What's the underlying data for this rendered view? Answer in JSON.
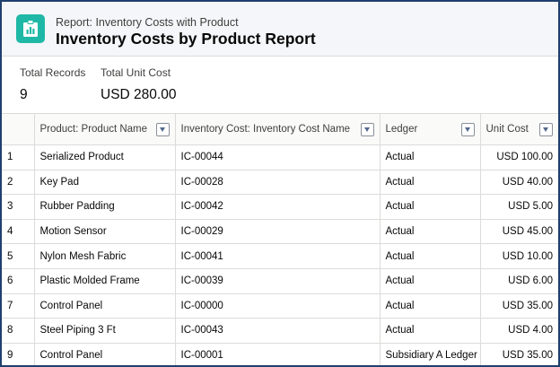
{
  "header": {
    "subtitle": "Report: Inventory Costs with Product",
    "title": "Inventory Costs by Product Report",
    "icon": "report-icon",
    "icon_color": "#1fb8a6"
  },
  "summary": {
    "total_records_label": "Total Records",
    "total_records_value": "9",
    "total_unit_cost_label": "Total Unit Cost",
    "total_unit_cost_value": "USD 280.00"
  },
  "table": {
    "columns": [
      {
        "label": "Product: Product Name"
      },
      {
        "label": "Inventory Cost: Inventory Cost Name"
      },
      {
        "label": "Ledger"
      },
      {
        "label": "Unit Cost"
      }
    ],
    "rows": [
      {
        "num": "1",
        "product": "Serialized Product",
        "cost_name": "IC-00044",
        "ledger": "Actual",
        "unit_cost": "USD 100.00"
      },
      {
        "num": "2",
        "product": "Key Pad",
        "cost_name": "IC-00028",
        "ledger": "Actual",
        "unit_cost": "USD 40.00"
      },
      {
        "num": "3",
        "product": "Rubber Padding",
        "cost_name": "IC-00042",
        "ledger": "Actual",
        "unit_cost": "USD 5.00"
      },
      {
        "num": "4",
        "product": "Motion Sensor",
        "cost_name": "IC-00029",
        "ledger": "Actual",
        "unit_cost": "USD 45.00"
      },
      {
        "num": "5",
        "product": "Nylon Mesh Fabric",
        "cost_name": "IC-00041",
        "ledger": "Actual",
        "unit_cost": "USD 10.00"
      },
      {
        "num": "6",
        "product": "Plastic Molded Frame",
        "cost_name": "IC-00039",
        "ledger": "Actual",
        "unit_cost": "USD 6.00"
      },
      {
        "num": "7",
        "product": "Control Panel",
        "cost_name": "IC-00000",
        "ledger": "Actual",
        "unit_cost": "USD 35.00"
      },
      {
        "num": "8",
        "product": "Steel Piping 3 Ft",
        "cost_name": "IC-00043",
        "ledger": "Actual",
        "unit_cost": "USD 4.00"
      },
      {
        "num": "9",
        "product": "Control Panel",
        "cost_name": "IC-00001",
        "ledger": "Subsidiary A Ledger",
        "unit_cost": "USD 35.00"
      }
    ]
  },
  "colors": {
    "link": "#1466c0",
    "frame_border": "#1f3f6e"
  }
}
